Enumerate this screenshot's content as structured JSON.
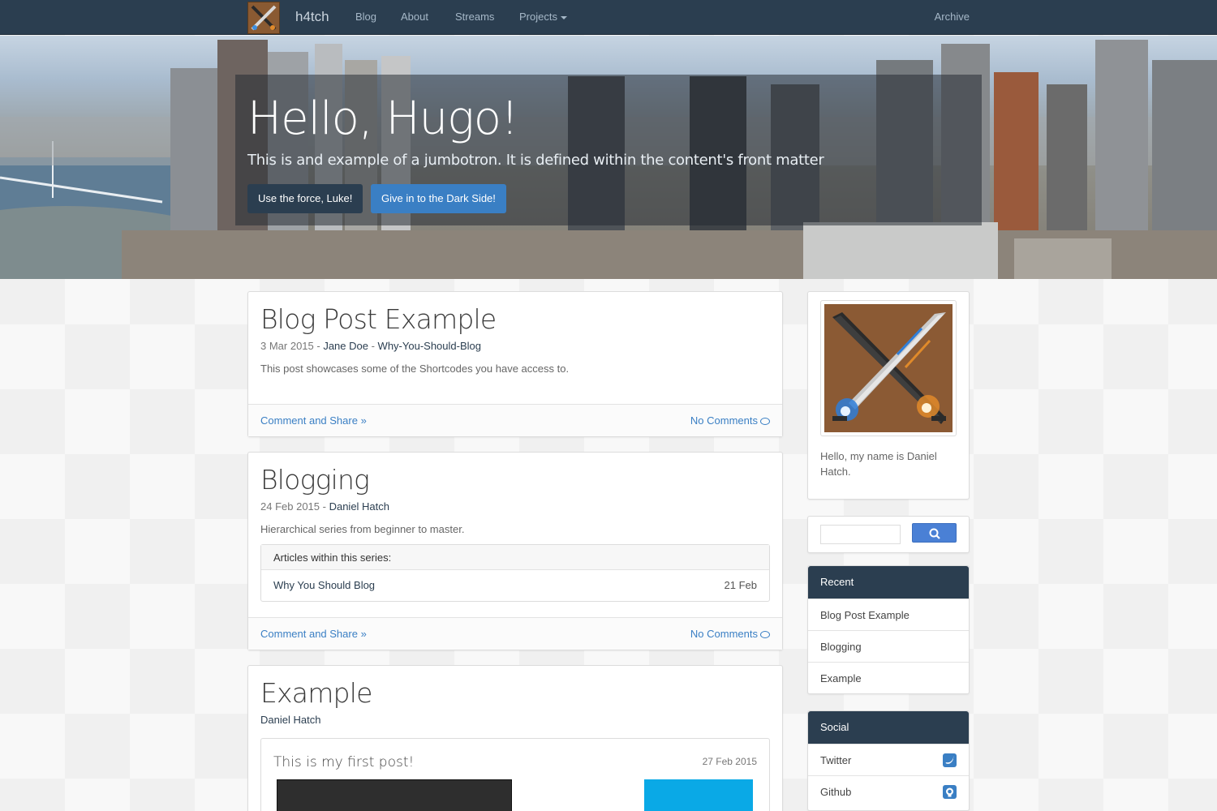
{
  "nav": {
    "brand": "h4tch",
    "links": [
      "Blog",
      "About",
      "Streams",
      "Projects"
    ],
    "archive": "Archive"
  },
  "hero": {
    "title": "Hello, Hugo!",
    "lead": "This is and example of a jumbotron. It is defined within the content's front matter",
    "button_primary": "Use the force, Luke!",
    "button_secondary": "Give in to the Dark Side!"
  },
  "posts": [
    {
      "title": "Blog Post Example",
      "date": "3 Mar 2015",
      "author": "Jane Doe",
      "series": "Why-You-Should-Blog",
      "summary": "This post showcases some of the Shortcodes you have access to.",
      "comment_share": "Comment and Share »",
      "comments": "No Comments"
    },
    {
      "title": "Blogging",
      "date": "24 Feb 2015",
      "author": "Daniel Hatch",
      "summary": "Hierarchical series from beginner to master.",
      "series_header": "Articles within this series:",
      "series_items": [
        {
          "title": "Why You Should Blog",
          "date": "21 Feb"
        }
      ],
      "comment_share": "Comment and Share »",
      "comments": "No Comments"
    },
    {
      "title": "Example",
      "author": "Daniel Hatch",
      "inner_post": {
        "title": "This is my first post!",
        "date": "27 Feb 2015"
      }
    }
  ],
  "sidebar": {
    "about": "Hello, my name is Daniel Hatch.",
    "recent": {
      "header": "Recent",
      "items": [
        "Blog Post Example",
        "Blogging",
        "Example"
      ]
    },
    "social": {
      "header": "Social",
      "items": [
        {
          "label": "Twitter",
          "icon": "twitter-icon"
        },
        {
          "label": "Github",
          "icon": "github-icon"
        }
      ]
    }
  },
  "colors": {
    "navbar": "#2b3e50",
    "accent_blue": "#3a7fc4",
    "panel_header": "#2b3e50"
  }
}
